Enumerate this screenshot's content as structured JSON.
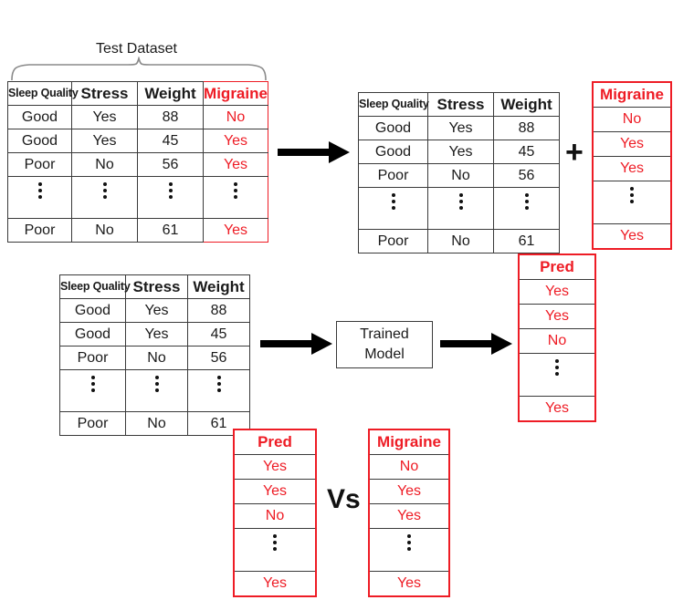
{
  "diagram": {
    "title_caption": "Test Dataset",
    "plus_symbol": "+",
    "vs_symbol": "Vs",
    "model_line1": "Trained",
    "model_line2": "Model",
    "dots_symbol": "⋮"
  },
  "full_table": {
    "headers": [
      "Sleep Quality",
      "Stress",
      "Weight",
      "Migraine"
    ],
    "rows": [
      [
        "Good",
        "Yes",
        "88",
        "No"
      ],
      [
        "Good",
        "Yes",
        "45",
        "Yes"
      ],
      [
        "Poor",
        "No",
        "56",
        "Yes"
      ],
      [
        "dots",
        "dots",
        "dots",
        "dots"
      ],
      [
        "Poor",
        "No",
        "61",
        "Yes"
      ]
    ]
  },
  "features_table_top": {
    "headers": [
      "Sleep Quality",
      "Stress",
      "Weight"
    ],
    "rows": [
      [
        "Good",
        "Yes",
        "88"
      ],
      [
        "Good",
        "Yes",
        "45"
      ],
      [
        "Poor",
        "No",
        "56"
      ],
      [
        "dots",
        "dots",
        "dots"
      ],
      [
        "Poor",
        "No",
        "61"
      ]
    ]
  },
  "migraine_column_top": {
    "header": "Migraine",
    "values": [
      "No",
      "Yes",
      "Yes",
      "dots",
      "Yes"
    ]
  },
  "features_table_mid": {
    "headers": [
      "Sleep Quality",
      "Stress",
      "Weight"
    ],
    "rows": [
      [
        "Good",
        "Yes",
        "88"
      ],
      [
        "Good",
        "Yes",
        "45"
      ],
      [
        "Poor",
        "No",
        "56"
      ],
      [
        "dots",
        "dots",
        "dots"
      ],
      [
        "Poor",
        "No",
        "61"
      ]
    ]
  },
  "pred_column_mid": {
    "header": "Pred",
    "values": [
      "Yes",
      "Yes",
      "No",
      "dots",
      "Yes"
    ]
  },
  "pred_column_bottom": {
    "header": "Pred",
    "values": [
      "Yes",
      "Yes",
      "No",
      "dots",
      "Yes"
    ]
  },
  "migraine_column_bottom": {
    "header": "Migraine",
    "values": [
      "No",
      "Yes",
      "Yes",
      "dots",
      "Yes"
    ]
  },
  "colors": {
    "accent_red": "#ee1c25",
    "text_black": "#1a1a1a",
    "border_gray": "#3a3a3a",
    "brace_gray": "#8a8a8a"
  }
}
